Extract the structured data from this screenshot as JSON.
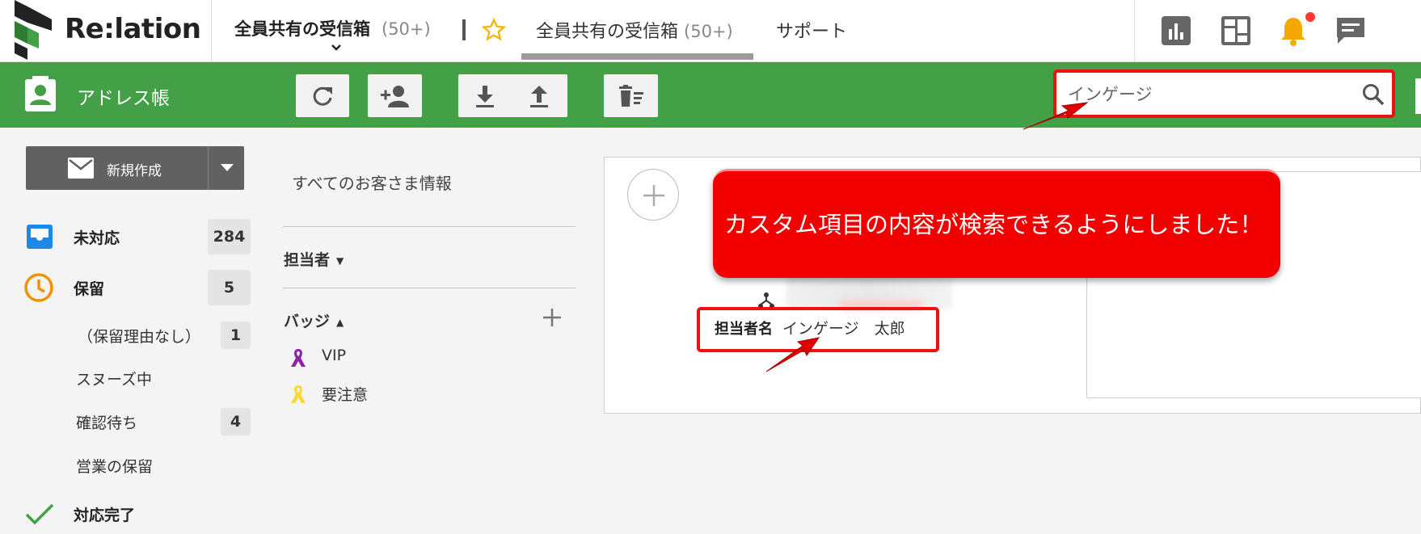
{
  "header": {
    "logo_text": "Re:lation",
    "workspace": {
      "name": "全員共有の受信箱",
      "count": "(50+)"
    },
    "tabs": [
      {
        "label": "全員共有の受信箱",
        "count": "(50+)",
        "active": true
      },
      {
        "label": "サポート",
        "active": false
      }
    ],
    "icons": [
      "report-icon",
      "dashboard-icon",
      "bell-icon",
      "chat-icon"
    ]
  },
  "toolbar": {
    "title": "アドレス帳",
    "buttons": [
      "refresh-icon",
      "add-person-icon",
      "download-icon",
      "upload-icon",
      "delete-list-icon"
    ],
    "search": {
      "value": "インゲージ",
      "placeholder": "インゲージ"
    }
  },
  "sidebar": {
    "compose_label": "新規作成",
    "items": [
      {
        "label": "未対応",
        "count": "284",
        "icon": "inbox-icon"
      },
      {
        "label": "保留",
        "count": "5",
        "icon": "clock-icon"
      },
      {
        "label": "（保留理由なし）",
        "count": "1"
      },
      {
        "label": "スヌーズ中",
        "count": ""
      },
      {
        "label": "確認待ち",
        "count": "4"
      },
      {
        "label": "営業の保留",
        "count": ""
      },
      {
        "label": "対応完了",
        "count": "",
        "icon": "check-icon"
      }
    ]
  },
  "filters": {
    "all_label": "すべてのお客さま情報",
    "assignee_label": "担当者",
    "badge_label": "バッジ",
    "badges": [
      {
        "label": "VIP",
        "color": "#8e24aa"
      },
      {
        "label": "要注意",
        "color": "#fdd835"
      }
    ]
  },
  "contact": {
    "assignee_label": "担当者名",
    "assignee_value": "インゲージ　太郎"
  },
  "callout": {
    "text": "カスタム項目の内容が検索できるようにしました！"
  },
  "colors": {
    "toolbar_green": "#43a047",
    "annotation_red": "#ee1111",
    "badge_bg": "#e4e4e4"
  }
}
